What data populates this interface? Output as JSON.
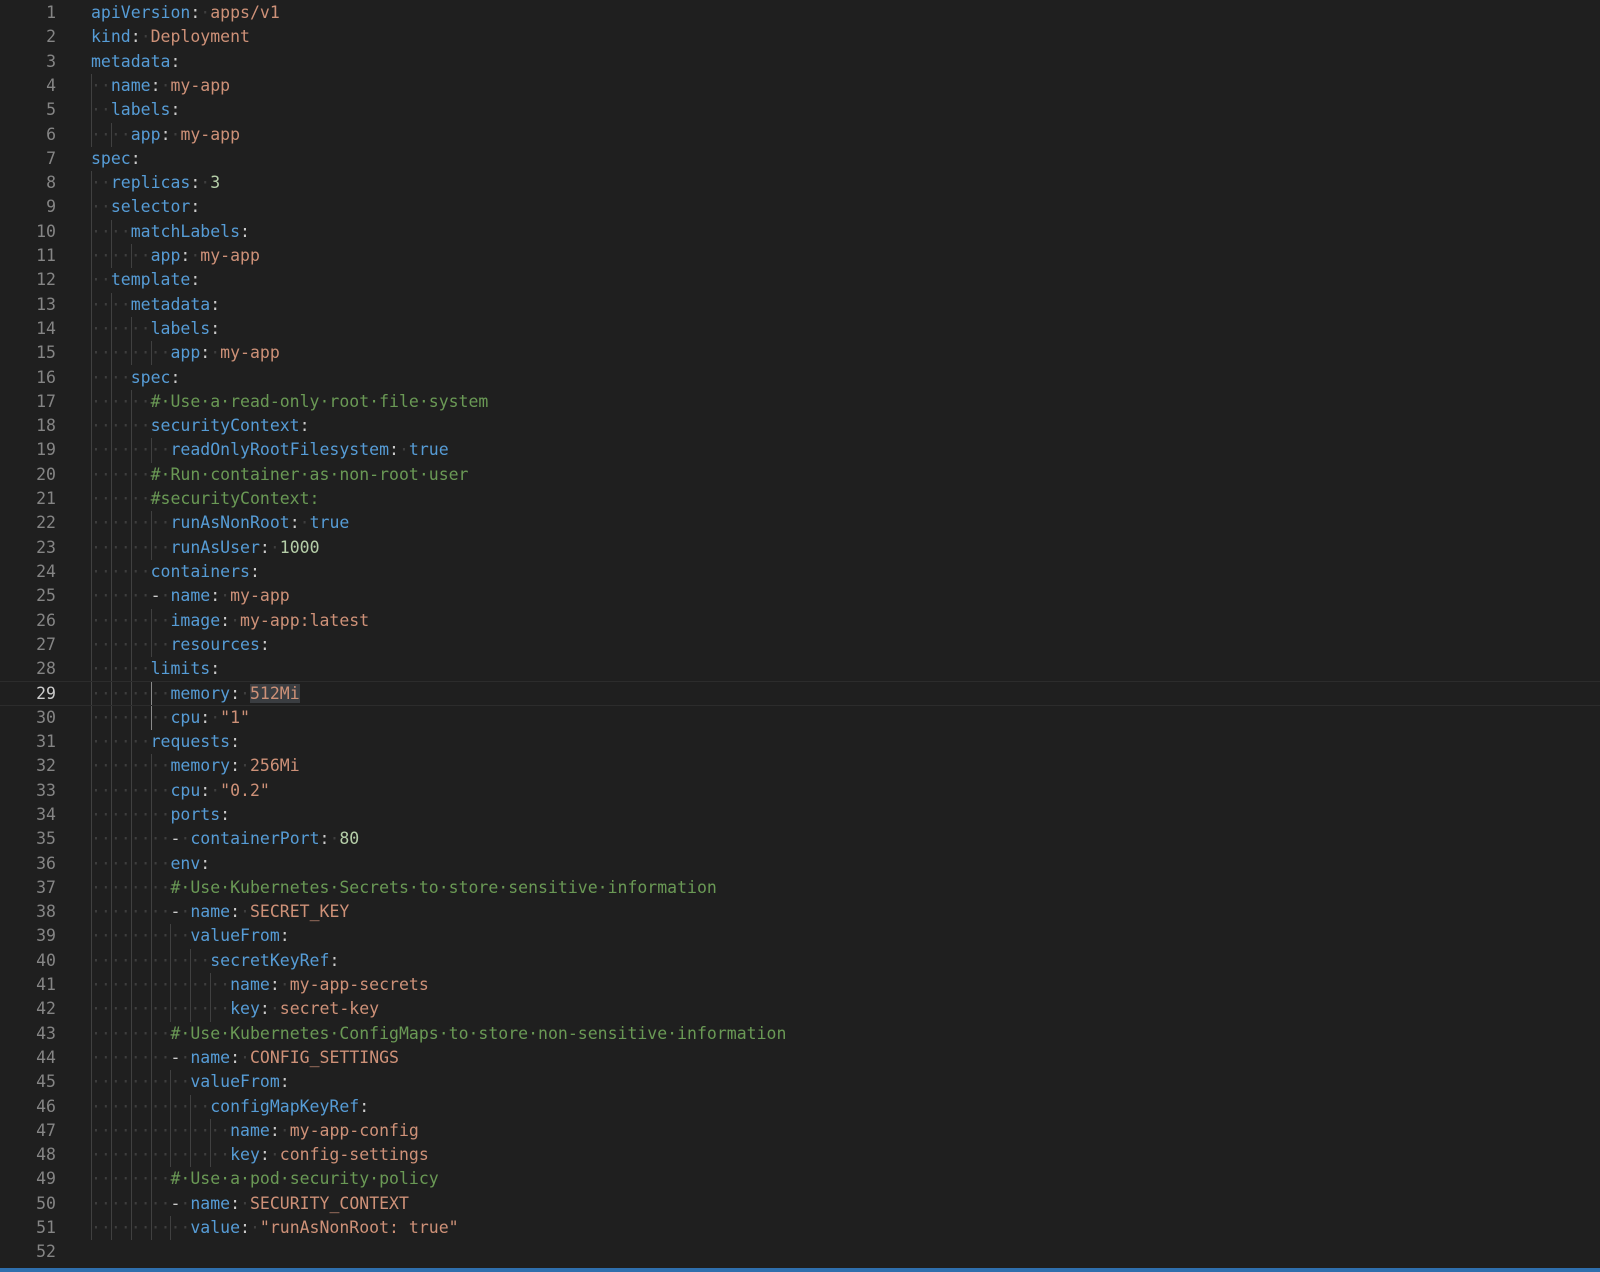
{
  "editor": {
    "current_line": 29,
    "lines": [
      {
        "n": "1",
        "i": 0,
        "t": [
          [
            "k",
            "apiVersion"
          ],
          [
            "p",
            ":"
          ],
          [
            "w",
            " "
          ],
          [
            "s",
            "apps/v1"
          ]
        ]
      },
      {
        "n": "2",
        "i": 0,
        "t": [
          [
            "k",
            "kind"
          ],
          [
            "p",
            ":"
          ],
          [
            "w",
            " "
          ],
          [
            "s",
            "Deployment"
          ]
        ]
      },
      {
        "n": "3",
        "i": 0,
        "t": [
          [
            "k",
            "metadata"
          ],
          [
            "p",
            ":"
          ]
        ]
      },
      {
        "n": "4",
        "i": 1,
        "t": [
          [
            "k",
            "name"
          ],
          [
            "p",
            ":"
          ],
          [
            "w",
            " "
          ],
          [
            "s",
            "my-app"
          ]
        ]
      },
      {
        "n": "5",
        "i": 1,
        "t": [
          [
            "k",
            "labels"
          ],
          [
            "p",
            ":"
          ]
        ]
      },
      {
        "n": "6",
        "i": 2,
        "t": [
          [
            "k",
            "app"
          ],
          [
            "p",
            ":"
          ],
          [
            "w",
            " "
          ],
          [
            "s",
            "my-app"
          ]
        ]
      },
      {
        "n": "7",
        "i": 0,
        "t": [
          [
            "k",
            "spec"
          ],
          [
            "p",
            ":"
          ]
        ]
      },
      {
        "n": "8",
        "i": 1,
        "t": [
          [
            "k",
            "replicas"
          ],
          [
            "p",
            ":"
          ],
          [
            "w",
            " "
          ],
          [
            "n",
            "3"
          ]
        ]
      },
      {
        "n": "9",
        "i": 1,
        "t": [
          [
            "k",
            "selector"
          ],
          [
            "p",
            ":"
          ]
        ]
      },
      {
        "n": "10",
        "i": 2,
        "t": [
          [
            "k",
            "matchLabels"
          ],
          [
            "p",
            ":"
          ]
        ]
      },
      {
        "n": "11",
        "i": 3,
        "t": [
          [
            "k",
            "app"
          ],
          [
            "p",
            ":"
          ],
          [
            "w",
            " "
          ],
          [
            "s",
            "my-app"
          ]
        ]
      },
      {
        "n": "12",
        "i": 1,
        "t": [
          [
            "k",
            "template"
          ],
          [
            "p",
            ":"
          ]
        ]
      },
      {
        "n": "13",
        "i": 2,
        "t": [
          [
            "k",
            "metadata"
          ],
          [
            "p",
            ":"
          ]
        ]
      },
      {
        "n": "14",
        "i": 3,
        "t": [
          [
            "k",
            "labels"
          ],
          [
            "p",
            ":"
          ]
        ]
      },
      {
        "n": "15",
        "i": 4,
        "t": [
          [
            "k",
            "app"
          ],
          [
            "p",
            ":"
          ],
          [
            "w",
            " "
          ],
          [
            "s",
            "my-app"
          ]
        ]
      },
      {
        "n": "16",
        "i": 2,
        "t": [
          [
            "k",
            "spec"
          ],
          [
            "p",
            ":"
          ]
        ]
      },
      {
        "n": "17",
        "i": 3,
        "t": [
          [
            "c",
            "# Use a read-only root file system"
          ]
        ]
      },
      {
        "n": "18",
        "i": 3,
        "t": [
          [
            "k",
            "securityContext"
          ],
          [
            "p",
            ":"
          ]
        ]
      },
      {
        "n": "19",
        "i": 4,
        "t": [
          [
            "k",
            "readOnlyRootFilesystem"
          ],
          [
            "p",
            ":"
          ],
          [
            "w",
            " "
          ],
          [
            "b",
            "true"
          ]
        ]
      },
      {
        "n": "20",
        "i": 3,
        "t": [
          [
            "c",
            "# Run container as non-root user"
          ]
        ]
      },
      {
        "n": "21",
        "i": 3,
        "t": [
          [
            "c",
            "#securityContext:"
          ]
        ]
      },
      {
        "n": "22",
        "i": 4,
        "t": [
          [
            "k",
            "runAsNonRoot"
          ],
          [
            "p",
            ":"
          ],
          [
            "w",
            " "
          ],
          [
            "b",
            "true"
          ]
        ]
      },
      {
        "n": "23",
        "i": 4,
        "t": [
          [
            "k",
            "runAsUser"
          ],
          [
            "p",
            ":"
          ],
          [
            "w",
            " "
          ],
          [
            "n",
            "1000"
          ]
        ]
      },
      {
        "n": "24",
        "i": 3,
        "t": [
          [
            "k",
            "containers"
          ],
          [
            "p",
            ":"
          ]
        ]
      },
      {
        "n": "25",
        "i": 3,
        "t": [
          [
            "d",
            "-"
          ],
          [
            "w",
            " "
          ],
          [
            "k",
            "name"
          ],
          [
            "p",
            ":"
          ],
          [
            "w",
            " "
          ],
          [
            "s",
            "my-app"
          ]
        ]
      },
      {
        "n": "26",
        "i": 4,
        "t": [
          [
            "k",
            "image"
          ],
          [
            "p",
            ":"
          ],
          [
            "w",
            " "
          ],
          [
            "s",
            "my-app:latest"
          ]
        ]
      },
      {
        "n": "27",
        "i": 4,
        "t": [
          [
            "k",
            "resources"
          ],
          [
            "p",
            ":"
          ]
        ]
      },
      {
        "n": "28",
        "i": 3,
        "t": [
          [
            "k",
            "limits"
          ],
          [
            "p",
            ":"
          ]
        ]
      },
      {
        "n": "29",
        "i": 4,
        "t": [
          [
            "k",
            "memory"
          ],
          [
            "p",
            ":"
          ],
          [
            "w",
            " "
          ],
          [
            "sh",
            "512Mi"
          ]
        ]
      },
      {
        "n": "30",
        "i": 4,
        "t": [
          [
            "k",
            "cpu"
          ],
          [
            "p",
            ":"
          ],
          [
            "w",
            " "
          ],
          [
            "s",
            "\"1\""
          ]
        ]
      },
      {
        "n": "31",
        "i": 3,
        "t": [
          [
            "k",
            "requests"
          ],
          [
            "p",
            ":"
          ]
        ]
      },
      {
        "n": "32",
        "i": 4,
        "t": [
          [
            "k",
            "memory"
          ],
          [
            "p",
            ":"
          ],
          [
            "w",
            " "
          ],
          [
            "s",
            "256Mi"
          ]
        ]
      },
      {
        "n": "33",
        "i": 4,
        "t": [
          [
            "k",
            "cpu"
          ],
          [
            "p",
            ":"
          ],
          [
            "w",
            " "
          ],
          [
            "s",
            "\"0.2\""
          ]
        ]
      },
      {
        "n": "34",
        "i": 4,
        "t": [
          [
            "k",
            "ports"
          ],
          [
            "p",
            ":"
          ]
        ]
      },
      {
        "n": "35",
        "i": 4,
        "t": [
          [
            "d",
            "-"
          ],
          [
            "w",
            " "
          ],
          [
            "k",
            "containerPort"
          ],
          [
            "p",
            ":"
          ],
          [
            "w",
            " "
          ],
          [
            "n",
            "80"
          ]
        ]
      },
      {
        "n": "36",
        "i": 4,
        "t": [
          [
            "k",
            "env"
          ],
          [
            "p",
            ":"
          ]
        ]
      },
      {
        "n": "37",
        "i": 4,
        "t": [
          [
            "c",
            "# Use Kubernetes Secrets to store sensitive information"
          ]
        ]
      },
      {
        "n": "38",
        "i": 4,
        "t": [
          [
            "d",
            "-"
          ],
          [
            "w",
            " "
          ],
          [
            "k",
            "name"
          ],
          [
            "p",
            ":"
          ],
          [
            "w",
            " "
          ],
          [
            "s",
            "SECRET_KEY"
          ]
        ]
      },
      {
        "n": "39",
        "i": 5,
        "t": [
          [
            "k",
            "valueFrom"
          ],
          [
            "p",
            ":"
          ]
        ]
      },
      {
        "n": "40",
        "i": 6,
        "t": [
          [
            "k",
            "secretKeyRef"
          ],
          [
            "p",
            ":"
          ]
        ]
      },
      {
        "n": "41",
        "i": 7,
        "t": [
          [
            "k",
            "name"
          ],
          [
            "p",
            ":"
          ],
          [
            "w",
            " "
          ],
          [
            "s",
            "my-app-secrets"
          ]
        ]
      },
      {
        "n": "42",
        "i": 7,
        "t": [
          [
            "k",
            "key"
          ],
          [
            "p",
            ":"
          ],
          [
            "w",
            " "
          ],
          [
            "s",
            "secret-key"
          ]
        ]
      },
      {
        "n": "43",
        "i": 4,
        "t": [
          [
            "c",
            "# Use Kubernetes ConfigMaps to store non-sensitive information"
          ]
        ]
      },
      {
        "n": "44",
        "i": 4,
        "t": [
          [
            "d",
            "-"
          ],
          [
            "w",
            " "
          ],
          [
            "k",
            "name"
          ],
          [
            "p",
            ":"
          ],
          [
            "w",
            " "
          ],
          [
            "s",
            "CONFIG_SETTINGS"
          ]
        ]
      },
      {
        "n": "45",
        "i": 5,
        "t": [
          [
            "k",
            "valueFrom"
          ],
          [
            "p",
            ":"
          ]
        ]
      },
      {
        "n": "46",
        "i": 6,
        "t": [
          [
            "k",
            "configMapKeyRef"
          ],
          [
            "p",
            ":"
          ]
        ]
      },
      {
        "n": "47",
        "i": 7,
        "t": [
          [
            "k",
            "name"
          ],
          [
            "p",
            ":"
          ],
          [
            "w",
            " "
          ],
          [
            "s",
            "my-app-config"
          ]
        ]
      },
      {
        "n": "48",
        "i": 7,
        "t": [
          [
            "k",
            "key"
          ],
          [
            "p",
            ":"
          ],
          [
            "w",
            " "
          ],
          [
            "s",
            "config-settings"
          ]
        ]
      },
      {
        "n": "49",
        "i": 4,
        "t": [
          [
            "c",
            "# Use a pod security policy"
          ]
        ]
      },
      {
        "n": "50",
        "i": 4,
        "t": [
          [
            "d",
            "-"
          ],
          [
            "w",
            " "
          ],
          [
            "k",
            "name"
          ],
          [
            "p",
            ":"
          ],
          [
            "w",
            " "
          ],
          [
            "s",
            "SECURITY_CONTEXT"
          ]
        ]
      },
      {
        "n": "51",
        "i": 5,
        "t": [
          [
            "k",
            "value"
          ],
          [
            "p",
            ":"
          ],
          [
            "w",
            " "
          ],
          [
            "s",
            "\"runAsNonRoot: true\""
          ]
        ]
      },
      {
        "n": "52",
        "i": 0,
        "t": []
      }
    ]
  }
}
